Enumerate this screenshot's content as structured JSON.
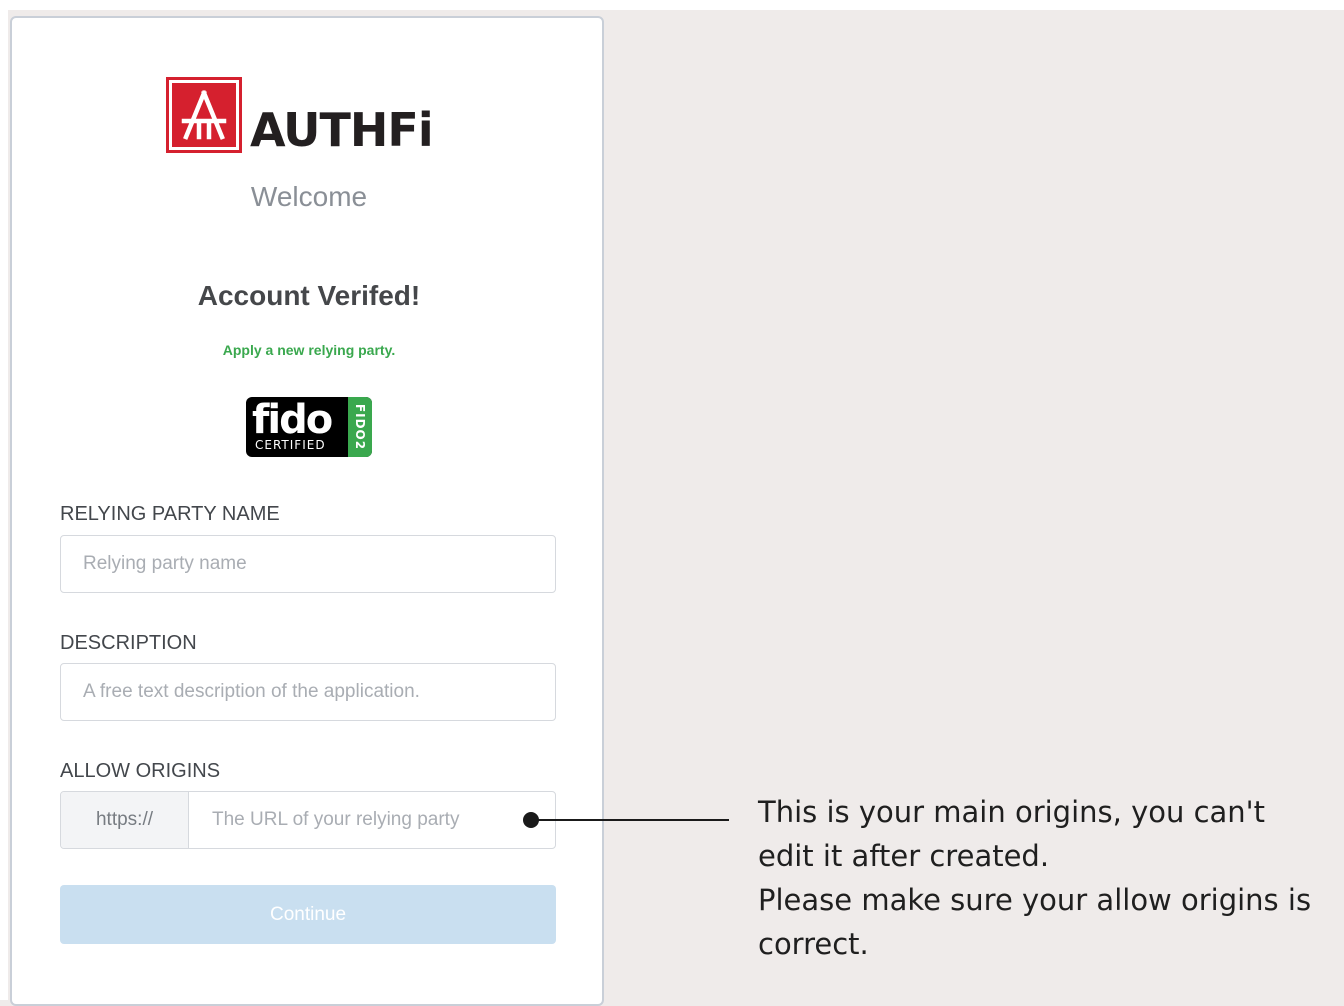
{
  "brand": {
    "logo_text": "AUTHFi",
    "welcome": "Welcome"
  },
  "card": {
    "heading": "Account Verifed!",
    "subtitle": "Apply a new relying party."
  },
  "fido_badge": {
    "word": "fido",
    "certified": "CERTIFIED",
    "version": "FIDO2"
  },
  "form": {
    "relying_party_name": {
      "label": "RELYING PARTY NAME",
      "placeholder": "Relying party name",
      "value": ""
    },
    "description": {
      "label": "DESCRIPTION",
      "placeholder": "A free text description of the application.",
      "value": ""
    },
    "allow_origins": {
      "label": "ALLOW ORIGINS",
      "prefix": "https://",
      "placeholder": "The URL of your relying party",
      "value": ""
    },
    "continue_label": "Continue"
  },
  "annotation": {
    "lines": [
      "This is your main origins, you can't",
      "edit it after created.",
      "Please make sure your allow origins is",
      "correct."
    ]
  },
  "colors": {
    "brand_red": "#d5202e",
    "accent_green": "#3aa84e",
    "button_disabled": "#c9dff0",
    "backdrop": "#efebea"
  }
}
